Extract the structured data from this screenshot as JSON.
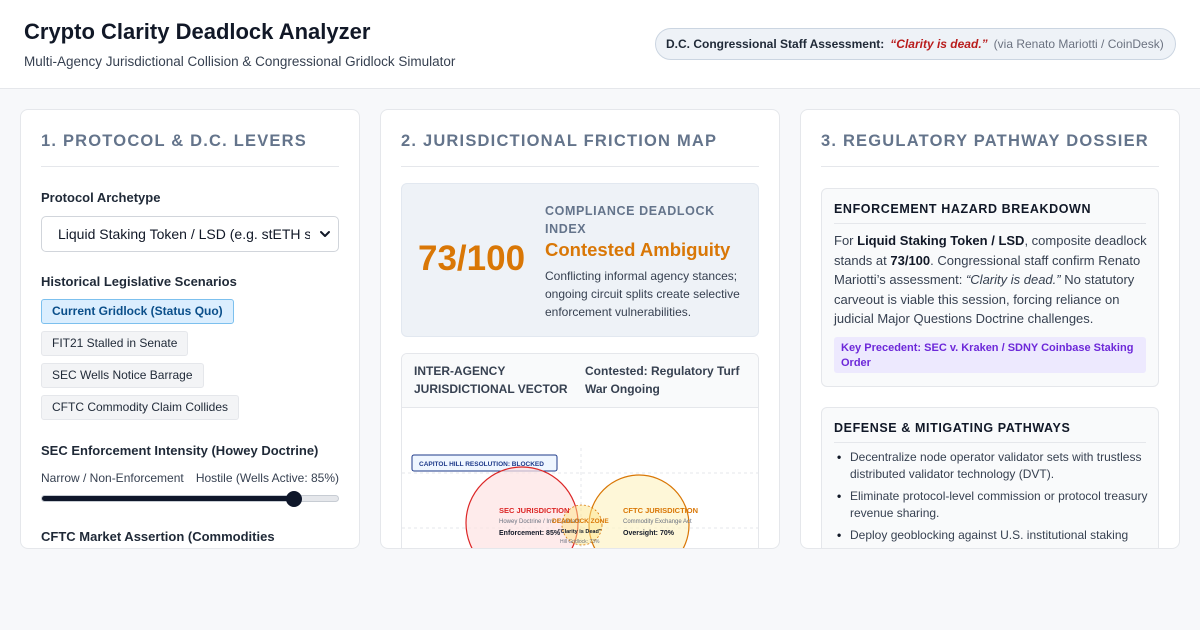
{
  "header": {
    "title": "Crypto Clarity Deadlock Analyzer",
    "subtitle": "Multi-Agency Jurisdictional Collision & Congressional Gridlock Simulator",
    "assessment_label": "D.C. Congressional Staff Assessment:",
    "assessment_quote": "“Clarity is dead.”",
    "assessment_source": "(via Renato Mariotti / CoinDesk)"
  },
  "levers": {
    "title": "1. PROTOCOL & D.C. LEVERS",
    "archetype_label": "Protocol Archetype",
    "archetype_value": "Liquid Staking Token / LSD (e.g. stETH s",
    "scenarios_label": "Historical Legislative Scenarios",
    "scenarios": [
      {
        "label": "Current Gridlock (Status Quo)",
        "active": true
      },
      {
        "label": "FIT21 Stalled in Senate",
        "active": false
      },
      {
        "label": "SEC Wells Notice Barrage",
        "active": false
      },
      {
        "label": "CFTC Commodity Claim Collides",
        "active": false
      }
    ],
    "sec_label": "SEC Enforcement Intensity (Howey Doctrine)",
    "sec_min_label": "Narrow / Non-Enforcement",
    "sec_max_label": "Hostile (Wells Active: 85%)",
    "sec_value": 85,
    "cftc_label": "CFTC Market Assertion (Commodities"
  },
  "friction": {
    "title": "2. JURISDICTIONAL FRICTION MAP",
    "score": "73/100",
    "index_label": "COMPLIANCE DEADLOCK INDEX",
    "status": "Contested Ambiguity",
    "description": "Conflicting informal agency stances; ongoing circuit splits create selective enforcement vulnerabilities.",
    "vector_label": "INTER-AGENCY JURISDICTIONAL VECTOR",
    "vector_status": "Contested: Regulatory Turf War Ongoing",
    "map": {
      "hill_badge": "CAPITOL HILL RESOLUTION: BLOCKED",
      "sec_title": "SEC JURISDICTION",
      "sec_sub": "Howey Doctrine / Inv. Contract",
      "sec_stat": "Enforcement: 85%",
      "zone_title": "DEADLOCK ZONE",
      "zone_quote": "\"Clarity is Dead\"",
      "zone_stat": "Hill Gridlock: 73%",
      "cftc_title": "CFTC JURISDICTION",
      "cftc_sub": "Commodity Exchange Act",
      "cftc_stat": "Oversight: 70%",
      "colors": {
        "sec": "#dc2626",
        "cftc": "#d97706",
        "hill": "#1e3a8a"
      }
    }
  },
  "dossier": {
    "title": "3. REGULATORY PATHWAY DOSSIER",
    "hazard_title": "ENFORCEMENT HAZARD BREAKDOWN",
    "hazard_t1": "For ",
    "hazard_protocol": "Liquid Staking Token / LSD",
    "hazard_t2": ", composite deadlock stands at ",
    "hazard_score": "73/100",
    "hazard_t3": ". Congressional staff confirm Renato Mariotti’s assessment: ",
    "hazard_quote": "“Clarity is dead.”",
    "hazard_t4": " No statutory carveout is viable this session, forcing reliance on judicial Major Questions Doctrine challenges.",
    "precedent": "Key Precedent: SEC v. Kraken / SDNY Coinbase Staking Order",
    "defense_title": "DEFENSE & MITIGATING PATHWAYS",
    "defense_items": [
      "Decentralize node operator validator sets with trustless distributed validator technology (DVT).",
      "Eliminate protocol-level commission or protocol treasury revenue sharing.",
      "Deploy geoblocking against U.S. institutional staking"
    ]
  }
}
